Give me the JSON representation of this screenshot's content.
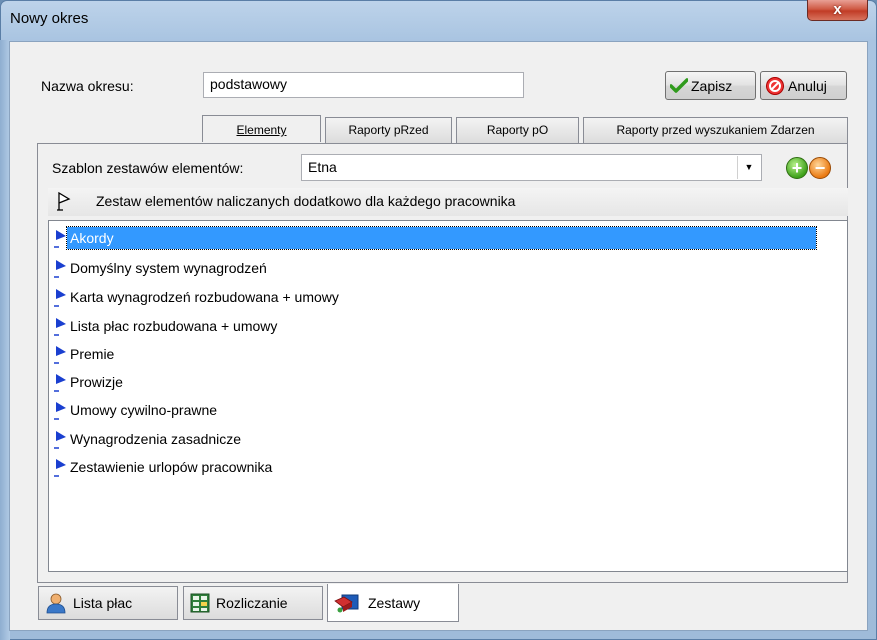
{
  "window": {
    "title": "Nowy okres",
    "close_label": "x"
  },
  "header": {
    "name_label": "Nazwa okresu:",
    "name_value": "podstawowy",
    "save_label": "Zapisz",
    "cancel_label": "Anuluj"
  },
  "tabs": [
    {
      "label": "Elementy",
      "active": true
    },
    {
      "label": "Raporty pRzed",
      "active": false
    },
    {
      "label": "Raporty pO",
      "active": false
    },
    {
      "label": "Raporty przed wyszukaniem Zdarzen",
      "active": false
    }
  ],
  "template": {
    "label": "Szablon zestawów elementów:",
    "value": "Etna"
  },
  "set_header": "Zestaw elementów naliczanych dodatkowo dla każdego pracownika",
  "list_items": [
    "Akordy",
    "Domyślny system wynagrodzeń",
    "Karta wynagrodzeń rozbudowana + umowy",
    "Lista płac rozbudowana + umowy",
    "Premie",
    "Prowizje",
    "Umowy cywilno-prawne",
    "Wynagrodzenia zasadnicze",
    "Zestawienie urlopów pracownika"
  ],
  "selected_item": "Akordy",
  "bottom_tabs": [
    {
      "label": "Lista płac",
      "icon": "user-icon",
      "active": false
    },
    {
      "label": "Rozliczanie",
      "icon": "spreadsheet-icon",
      "active": false
    },
    {
      "label": "Zestawy",
      "icon": "sets-icon",
      "active": true
    }
  ],
  "colors": {
    "selection": "#3399ff",
    "window_frame": "#a9c4e1",
    "close_button": "#c13c26"
  }
}
